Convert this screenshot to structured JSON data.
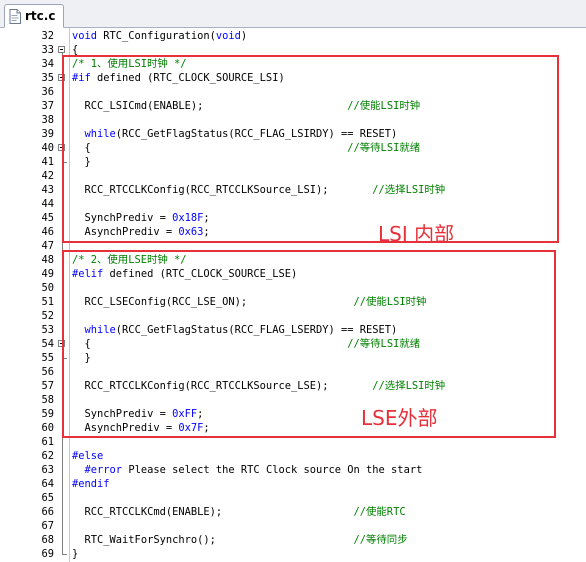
{
  "tab": {
    "label": "rtc.c",
    "icon": "c-file-icon"
  },
  "annotations": {
    "lsi": "LSI 内部",
    "lse": "LSE外部"
  },
  "colors": {
    "keyword": "#0000ff",
    "comment": "#008000",
    "number": "#0000ff",
    "highlight_box": "#e6303a"
  },
  "lines": [
    {
      "num": "32",
      "tokens": [
        {
          "t": "void ",
          "c": "kw"
        },
        {
          "t": "RTC_Configuration(",
          "c": ""
        },
        {
          "t": "void",
          "c": "kw"
        },
        {
          "t": ")",
          "c": ""
        }
      ]
    },
    {
      "num": "33",
      "fold": "open",
      "tokens": [
        {
          "t": "{",
          "c": ""
        }
      ]
    },
    {
      "num": "34",
      "tokens": [
        {
          "t": "/* 1、使用LSI时钟 */",
          "c": "cm"
        }
      ]
    },
    {
      "num": "35",
      "fold": "open",
      "tokens": [
        {
          "t": "#if ",
          "c": "kw"
        },
        {
          "t": "defined (RTC_CLOCK_SOURCE_LSI)",
          "c": ""
        }
      ]
    },
    {
      "num": "36",
      "tokens": []
    },
    {
      "num": "37",
      "tokens": [
        {
          "t": "  RCC_LSICmd(ENABLE);                       ",
          "c": ""
        },
        {
          "t": "//使能LSI时钟",
          "c": "cm"
        }
      ]
    },
    {
      "num": "38",
      "tokens": []
    },
    {
      "num": "39",
      "tokens": [
        {
          "t": "  ",
          "c": ""
        },
        {
          "t": "while",
          "c": "kw"
        },
        {
          "t": "(RCC_GetFlagStatus(RCC_FLAG_LSIRDY) == RESET)",
          "c": ""
        }
      ]
    },
    {
      "num": "40",
      "fold": "open",
      "tokens": [
        {
          "t": "  {                                         ",
          "c": ""
        },
        {
          "t": "//等待LSI就绪",
          "c": "cm"
        }
      ]
    },
    {
      "num": "41",
      "tokens": [
        {
          "t": "  }",
          "c": ""
        }
      ]
    },
    {
      "num": "42",
      "tokens": []
    },
    {
      "num": "43",
      "tokens": [
        {
          "t": "  RCC_RTCCLKConfig(RCC_RTCCLKSource_LSI);       ",
          "c": ""
        },
        {
          "t": "//选择LSI时钟",
          "c": "cm"
        }
      ]
    },
    {
      "num": "44",
      "tokens": []
    },
    {
      "num": "45",
      "tokens": [
        {
          "t": "  SynchPrediv = ",
          "c": ""
        },
        {
          "t": "0x18F",
          "c": "num"
        },
        {
          "t": ";",
          "c": ""
        }
      ]
    },
    {
      "num": "46",
      "tokens": [
        {
          "t": "  AsynchPrediv = ",
          "c": ""
        },
        {
          "t": "0x63",
          "c": "num"
        },
        {
          "t": ";",
          "c": ""
        }
      ]
    },
    {
      "num": "47",
      "tokens": []
    },
    {
      "num": "48",
      "tokens": [
        {
          "t": "/* 2、使用LSE时钟 */",
          "c": "cm"
        }
      ]
    },
    {
      "num": "49",
      "tokens": [
        {
          "t": "#elif ",
          "c": "kw"
        },
        {
          "t": "defined (RTC_CLOCK_SOURCE_LSE)",
          "c": ""
        }
      ]
    },
    {
      "num": "50",
      "tokens": []
    },
    {
      "num": "51",
      "tokens": [
        {
          "t": "  RCC_LSEConfig(RCC_LSE_ON);                 ",
          "c": ""
        },
        {
          "t": "//使能LSI时钟",
          "c": "cm"
        }
      ]
    },
    {
      "num": "52",
      "tokens": []
    },
    {
      "num": "53",
      "tokens": [
        {
          "t": "  ",
          "c": ""
        },
        {
          "t": "while",
          "c": "kw"
        },
        {
          "t": "(RCC_GetFlagStatus(RCC_FLAG_LSERDY) == RESET)",
          "c": ""
        }
      ]
    },
    {
      "num": "54",
      "fold": "open",
      "tokens": [
        {
          "t": "  {                                         ",
          "c": ""
        },
        {
          "t": "//等待LSI就绪",
          "c": "cm"
        }
      ]
    },
    {
      "num": "55",
      "tokens": [
        {
          "t": "  }",
          "c": ""
        }
      ]
    },
    {
      "num": "56",
      "tokens": []
    },
    {
      "num": "57",
      "tokens": [
        {
          "t": "  RCC_RTCCLKConfig(RCC_RTCCLKSource_LSE);       ",
          "c": ""
        },
        {
          "t": "//选择LSI时钟",
          "c": "cm"
        }
      ]
    },
    {
      "num": "58",
      "tokens": []
    },
    {
      "num": "59",
      "tokens": [
        {
          "t": "  SynchPrediv = ",
          "c": ""
        },
        {
          "t": "0xFF",
          "c": "num"
        },
        {
          "t": ";",
          "c": ""
        }
      ]
    },
    {
      "num": "60",
      "tokens": [
        {
          "t": "  AsynchPrediv = ",
          "c": ""
        },
        {
          "t": "0x7F",
          "c": "num"
        },
        {
          "t": ";",
          "c": ""
        }
      ]
    },
    {
      "num": "61",
      "tokens": []
    },
    {
      "num": "62",
      "tokens": [
        {
          "t": "#else",
          "c": "kw"
        }
      ]
    },
    {
      "num": "63",
      "tokens": [
        {
          "t": "  #error ",
          "c": "kw"
        },
        {
          "t": "Please select the RTC Clock source On the start",
          "c": ""
        }
      ]
    },
    {
      "num": "64",
      "tokens": [
        {
          "t": "#endif",
          "c": "kw"
        }
      ]
    },
    {
      "num": "65",
      "tokens": []
    },
    {
      "num": "66",
      "tokens": [
        {
          "t": "  RCC_RTCCLKCmd(ENABLE);                     ",
          "c": ""
        },
        {
          "t": "//使能RTC",
          "c": "cm"
        }
      ]
    },
    {
      "num": "67",
      "tokens": []
    },
    {
      "num": "68",
      "tokens": [
        {
          "t": "  RTC_WaitForSynchro();                      ",
          "c": ""
        },
        {
          "t": "//等待同步",
          "c": "cm"
        }
      ]
    },
    {
      "num": "69",
      "tokens": [
        {
          "t": "}",
          "c": ""
        }
      ]
    }
  ]
}
